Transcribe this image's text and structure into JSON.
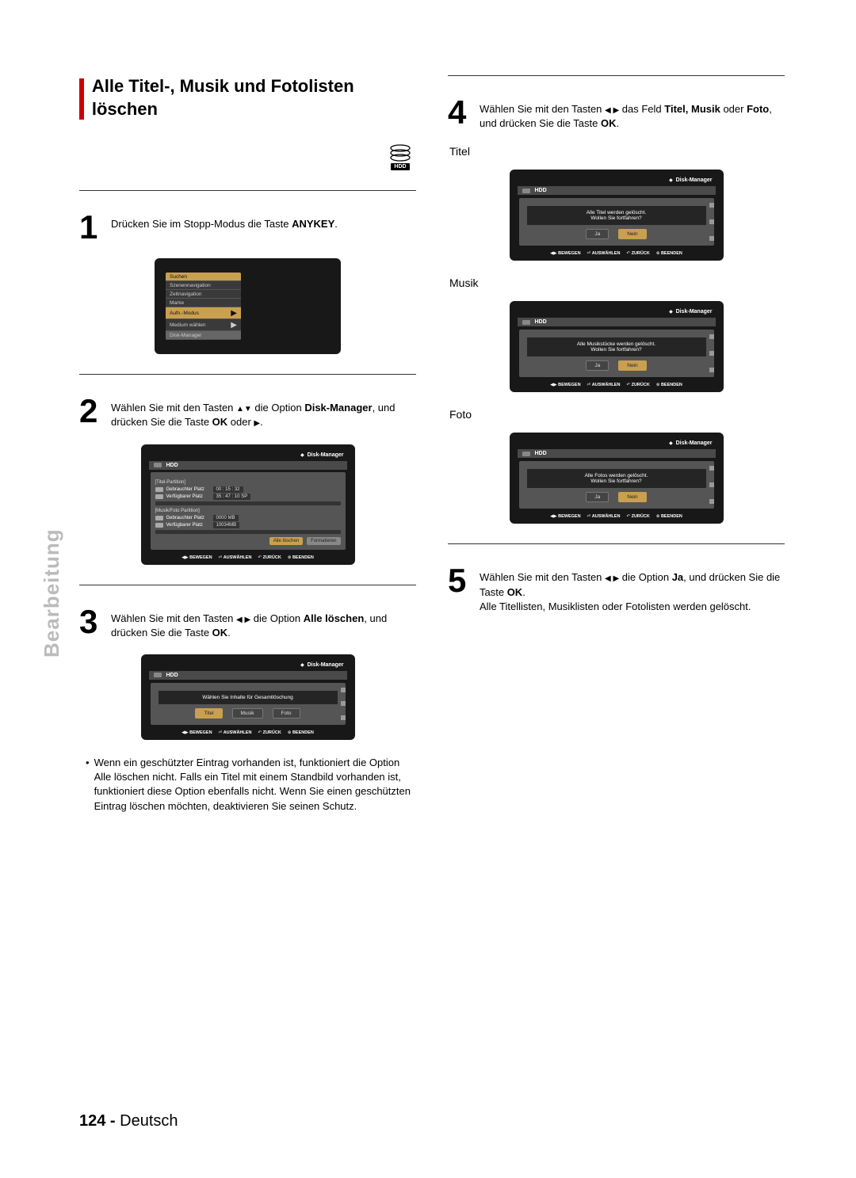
{
  "sideTab": "Bearbeitung",
  "section": {
    "title": "Alle Titel-, Musik und Fotolisten löschen"
  },
  "hdd": {
    "label": "HDD"
  },
  "steps": {
    "s1": {
      "num": "1",
      "text_a": "Drücken Sie im Stopp-Modus die Taste ",
      "key": "ANYKEY",
      "text_b": "."
    },
    "s2": {
      "num": "2",
      "text_a": "Wählen Sie mit den Tasten ",
      "arrows": "▲▼",
      "text_b": " die Option ",
      "opt": "Disk-Manager",
      "text_c": ", und drücken Sie die Taste ",
      "ok": "OK",
      "text_d": " oder ",
      "arrow2": "▶",
      "text_e": "."
    },
    "s3": {
      "num": "3",
      "text_a": "Wählen Sie mit den Tasten ",
      "arrows": "◀ ▶",
      "text_b": " die Option ",
      "opt": "Alle löschen",
      "text_c": ", und drücken Sie die Taste ",
      "ok": "OK",
      "text_d": "."
    },
    "s4": {
      "num": "4",
      "text_a": "Wählen Sie mit den Tasten ",
      "arrows": "◀ ▶",
      "text_b": " das Feld ",
      "opt": "Titel, Musik",
      "text_c": " oder ",
      "opt2": "Foto",
      "text_d": ", und drücken Sie die Taste ",
      "ok": "OK",
      "text_e": "."
    },
    "s5": {
      "num": "5",
      "text_a": "Wählen Sie mit den Tasten ",
      "arrows": "◀ ▶",
      "text_b": " die Option ",
      "opt": "Ja",
      "text_c": ", und drücken Sie die Taste ",
      "ok": "OK",
      "text_d": ".",
      "extra": "Alle Titellisten, Musiklisten oder Fotolisten werden gelöscht."
    }
  },
  "menu1": {
    "items": [
      "Suchen",
      "Szenennavigation",
      "Zeitnavigation",
      "Marke",
      "Aufn.-Modus",
      "Medium wählen",
      "Disk-Manager"
    ]
  },
  "dmScreen": {
    "title": "Disk-Manager",
    "drive": "HDD",
    "part1": "[Titel-Partition]",
    "used_label": "Gebrauchter Platz",
    "used_val": "00 : 15 : 32",
    "free_label": "Verfügbarer Platz",
    "free_val": "35 : 47 : 10 SP",
    "part2": "[Musik/Foto Partition]",
    "used2_val": "0000 MB",
    "free2_val": "10034MB",
    "btn_del": "Alle löschen",
    "btn_fmt": "Formatieren"
  },
  "footerBar": {
    "move": "BEWEGEN",
    "select": "AUSWÄHLEN",
    "back": "ZURÜCK",
    "exit": "BEENDEN"
  },
  "selectScreen": {
    "prompt": "Wählen Sie Inhalte für Gesamtlöschung",
    "b1": "Titel",
    "b2": "Musik",
    "b3": "Foto"
  },
  "confirm": {
    "titel": {
      "label": "Titel",
      "msg": "Alle Titel werden gelöscht.",
      "q": "Wollen Sie fortfahren?"
    },
    "musik": {
      "label": "Musik",
      "msg": "Alle Musikstücke werden gelöscht.",
      "q": "Wollen Sie fortfahren?"
    },
    "foto": {
      "label": "Foto",
      "msg": "Alle Fotos werden gelöscht.",
      "q": "Wollen Sie fortfahren?"
    },
    "yes": "Ja",
    "no": "Nein"
  },
  "note": "Wenn ein geschützter Eintrag vorhanden ist, funktioniert die Option Alle löschen nicht. Falls ein Titel mit einem Standbild vorhanden ist, funktioniert diese Option ebenfalls nicht. Wenn Sie einen geschützten Eintrag löschen möchten, deaktivieren Sie seinen Schutz.",
  "pageFooter": {
    "num": "124 -",
    "lang": "Deutsch"
  }
}
